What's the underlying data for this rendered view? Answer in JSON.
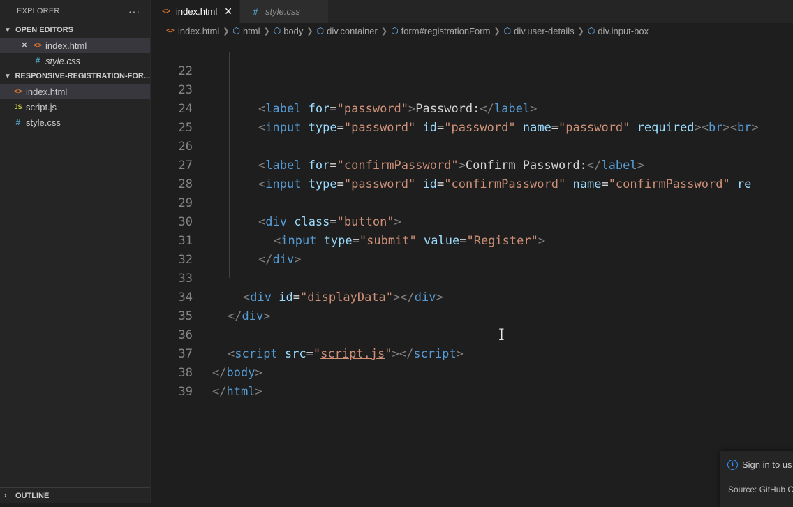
{
  "explorer": {
    "title": "EXPLORER",
    "more": "···",
    "open_editors": {
      "label": "OPEN EDITORS",
      "items": [
        {
          "name": "index.html",
          "icon": "html-file-icon",
          "close": "✕"
        },
        {
          "name": "style.css",
          "icon": "css-file-icon"
        }
      ]
    },
    "project": {
      "label": "RESPONSIVE-REGISTRATION-FOR...",
      "files": [
        {
          "name": "index.html",
          "icon": "html-file-icon"
        },
        {
          "name": "script.js",
          "icon": "js-file-icon"
        },
        {
          "name": "style.css",
          "icon": "css-file-icon"
        }
      ]
    },
    "outline": "OUTLINE"
  },
  "tabs": [
    {
      "label": "index.html",
      "active": true,
      "close": "✕"
    },
    {
      "label": "style.css",
      "active": false
    }
  ],
  "breadcrumb": [
    "index.html",
    "html",
    "body",
    "div.container",
    "form#registrationForm",
    "div.user-details",
    "div.input-box"
  ],
  "editor": {
    "line_numbers": [
      "22",
      "23",
      "24",
      "25",
      "26",
      "27",
      "28",
      "29",
      "30",
      "31",
      "32",
      "33",
      "34",
      "35",
      "36",
      "37",
      "38",
      "39"
    ],
    "strings": {
      "label": "label",
      "for": "for",
      "password_q": "\"password\"",
      "password_text": "Password:",
      "input": "input",
      "type": "type",
      "id": "id",
      "name": "name",
      "required": "required",
      "br": "br",
      "confirm_q": "\"confirmPassword\"",
      "confirm_text": "Confirm Password:",
      "req_cut": "re",
      "div": "div",
      "class": "class",
      "button_q": "\"button\"",
      "submit_q": "\"submit\"",
      "value": "value",
      "register_q": "\"Register\"",
      "display_q": "\"displayData\"",
      "script": "script",
      "src": "src",
      "script_js": "script.js",
      "body": "body",
      "html": "html"
    }
  },
  "notification": {
    "title": "Sign in to us",
    "source": "Source: GitHub Co"
  },
  "colors": {
    "tag": "#569cd6",
    "attr": "#9cdcfe",
    "string": "#ce9178",
    "text": "#d4d4d4",
    "bracket": "#808080"
  }
}
